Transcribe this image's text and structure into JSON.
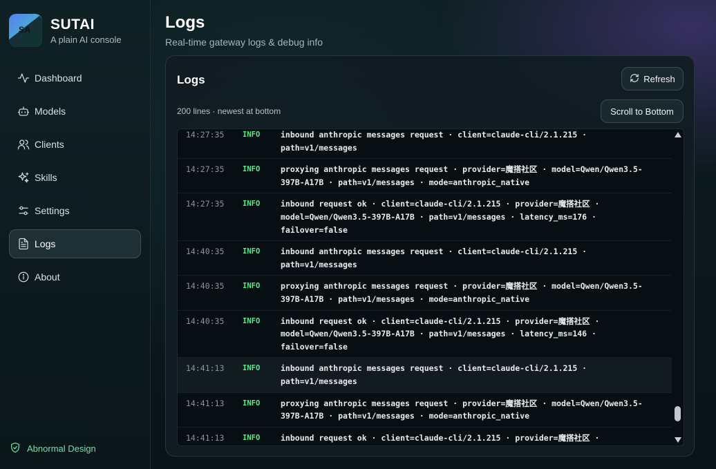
{
  "brand": {
    "logo_text": "SA",
    "name": "SUTAI",
    "subtitle": "A plain AI console"
  },
  "nav": {
    "items": [
      {
        "label": "Dashboard",
        "icon": "activity-icon"
      },
      {
        "label": "Models",
        "icon": "bot-icon"
      },
      {
        "label": "Clients",
        "icon": "users-icon"
      },
      {
        "label": "Skills",
        "icon": "sparkles-icon"
      },
      {
        "label": "Settings",
        "icon": "sliders-icon"
      },
      {
        "label": "Logs",
        "icon": "file-text-icon",
        "active": true
      },
      {
        "label": "About",
        "icon": "info-icon"
      }
    ]
  },
  "footer": {
    "label": "Abnormal Design",
    "icon": "shield-check-icon",
    "color": "#6fe3a3"
  },
  "header": {
    "title": "Logs",
    "subtitle": "Real-time gateway logs & debug info"
  },
  "card": {
    "title": "Logs",
    "refresh_label": "Refresh",
    "scroll_label": "Scroll to Bottom",
    "line_count": "200 lines · newest at bottom"
  },
  "logs": [
    {
      "time": "14:27:35",
      "level": "INFO",
      "message": "inbound anthropic messages request · client=claude-cli/2.1.215 ·\npath=v1/messages"
    },
    {
      "time": "14:27:35",
      "level": "INFO",
      "message": "proxying anthropic messages request · provider=魔搭社区 · model=Qwen/Qwen3.5-\n397B-A17B · path=v1/messages · mode=anthropic_native"
    },
    {
      "time": "14:27:35",
      "level": "INFO",
      "message": "inbound request ok · client=claude-cli/2.1.215 · provider=魔搭社区 ·\nmodel=Qwen/Qwen3.5-397B-A17B · path=v1/messages · latency_ms=176 ·\nfailover=false"
    },
    {
      "time": "14:40:35",
      "level": "INFO",
      "message": "inbound anthropic messages request · client=claude-cli/2.1.215 ·\npath=v1/messages"
    },
    {
      "time": "14:40:35",
      "level": "INFO",
      "message": "proxying anthropic messages request · provider=魔搭社区 · model=Qwen/Qwen3.5-\n397B-A17B · path=v1/messages · mode=anthropic_native"
    },
    {
      "time": "14:40:35",
      "level": "INFO",
      "message": "inbound request ok · client=claude-cli/2.1.215 · provider=魔搭社区 ·\nmodel=Qwen/Qwen3.5-397B-A17B · path=v1/messages · latency_ms=146 ·\nfailover=false"
    },
    {
      "time": "14:41:13",
      "level": "INFO",
      "message": "inbound anthropic messages request · client=claude-cli/2.1.215 ·\npath=v1/messages",
      "highlight": true
    },
    {
      "time": "14:41:13",
      "level": "INFO",
      "message": "proxying anthropic messages request · provider=魔搭社区 · model=Qwen/Qwen3.5-\n397B-A17B · path=v1/messages · mode=anthropic_native"
    },
    {
      "time": "14:41:13",
      "level": "INFO",
      "message": "inbound request ok · client=claude-cli/2.1.215 · provider=魔搭社区 ·"
    }
  ],
  "colors": {
    "accent": "#5fe38c",
    "active_bg": "#1e3034"
  }
}
